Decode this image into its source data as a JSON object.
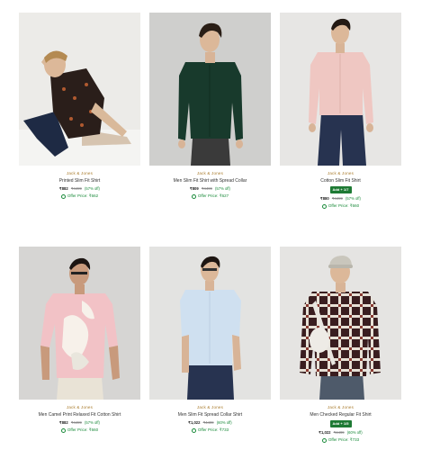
{
  "products": [
    {
      "brand": "Jack & Jones",
      "name": "Printed Slim Fit Shirt",
      "price": "₹882",
      "mrp": "₹4499",
      "discount": "(57% off)",
      "offer": "Offer Price: ₹662",
      "badge": "",
      "bg": "#ecebe8"
    },
    {
      "brand": "Jack & Jones",
      "name": "Men Slim Fit Shirt with Spread Collar",
      "price": "₹809",
      "mrp": "₹4499",
      "discount": "(57% off)",
      "offer": "Offer Price: ₹627",
      "badge": "",
      "bg": "#cfcfcd"
    },
    {
      "brand": "Jack & Jones",
      "name": "Cotton Slim Fit Shirt",
      "price": "₹880",
      "mrp": "₹4499",
      "discount": "(57% off)",
      "offer": "Offer Price: ₹660",
      "badge": "Add + 1/7",
      "bg": "#e7e6e4"
    },
    {
      "brand": "Jack & Jones",
      "name": "Men Camel Print Relaxed Fit Cotton Shirt",
      "price": "₹882",
      "mrp": "₹4499",
      "discount": "(57% off)",
      "offer": "Offer Price: ₹660",
      "badge": "",
      "bg": "#d6d5d3"
    },
    {
      "brand": "Jack & Jones",
      "name": "Men Slim Fit Spread Collar Shirt",
      "price": "₹1,022",
      "mrp": "₹4499",
      "discount": "(60% off)",
      "offer": "Offer Price: ₹733",
      "badge": "",
      "bg": "#e3e3e1"
    },
    {
      "brand": "Jack & Jones",
      "name": "Men Checked Regular Fit Shirt",
      "price": "₹1,022",
      "mrp": "₹4499",
      "discount": "(60% off)",
      "offer": "Offer Price: ₹733",
      "badge": "Add + 1/5",
      "bg": "#e5e4e2"
    }
  ]
}
